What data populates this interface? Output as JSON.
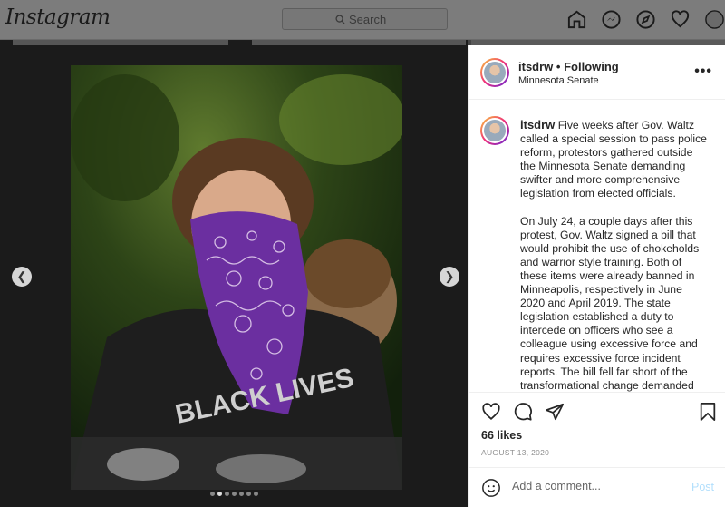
{
  "nav": {
    "logo": "Instagram",
    "search_placeholder": "Search",
    "icons": [
      "home-icon",
      "messenger-icon",
      "explore-icon",
      "heart-icon",
      "profile-icon"
    ]
  },
  "post": {
    "username": "itsdrw",
    "follow_status": "• Following",
    "location": "Minnesota Senate",
    "more_label": "•••",
    "caption_username": "itsdrw",
    "caption_p1": "Five weeks after Gov. Waltz called a special session to pass police reform, protestors gathered outside the Minnesota Senate demanding swifter and more comprehensive legislation from elected officials.",
    "caption_p2": "On July 24, a couple days after this protest, Gov. Waltz signed a bill that would prohibit the use of chokeholds and warrior style training. Both of these items were already banned in Minneapolis, respectively in June 2020 and April 2019. The state legislation established a duty to intercede on officers who see a colleague using excessive force and requires excessive force incident reports. The bill fell far short of the transformational change demanded after the murder of George",
    "likes": "66 likes",
    "date": "AUGUST 13, 2020",
    "carousel": {
      "count": 7,
      "active": 1
    },
    "shirt_text": "BLACK LIVES"
  },
  "comment": {
    "placeholder": "Add a comment...",
    "post_label": "Post"
  },
  "colors": {
    "accent": "#0095f6",
    "post_disabled": "#b2dffc",
    "bandana": "#6b2fa0"
  }
}
